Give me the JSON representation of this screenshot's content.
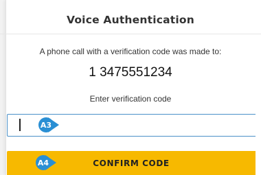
{
  "dialog": {
    "title": "Voice Authentication",
    "message": "A phone call with a verification code was made to:",
    "phone_number": "1 3475551234",
    "code_label": "Enter verification code"
  },
  "code_input": {
    "value": "",
    "placeholder": ""
  },
  "confirm_button": {
    "label": "CONFIRM CODE"
  },
  "annotations": {
    "input_badge": "A3",
    "button_badge": "A4"
  },
  "colors": {
    "button_bg": "#f7b900",
    "input_border": "#4a90c8",
    "badge": "#2a8fd4"
  }
}
